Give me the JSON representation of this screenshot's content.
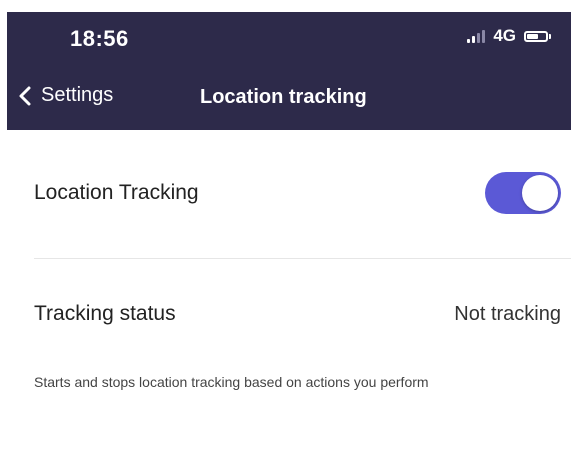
{
  "status_bar": {
    "time": "18:56",
    "network": "4G",
    "battery_level": 0.6
  },
  "nav": {
    "back_label": "Settings",
    "title": "Location tracking"
  },
  "settings": {
    "location_tracking": {
      "label": "Location Tracking",
      "enabled": true
    },
    "tracking_status": {
      "label": "Tracking status",
      "value": "Not tracking"
    },
    "helper_text": "Starts and stops location tracking based on actions you perform"
  },
  "colors": {
    "header_bg": "#2d2a4a",
    "toggle_on": "#5b59d6"
  },
  "icons": {
    "back": "chevron-left-icon",
    "signal": "signal-icon",
    "battery": "battery-icon"
  }
}
